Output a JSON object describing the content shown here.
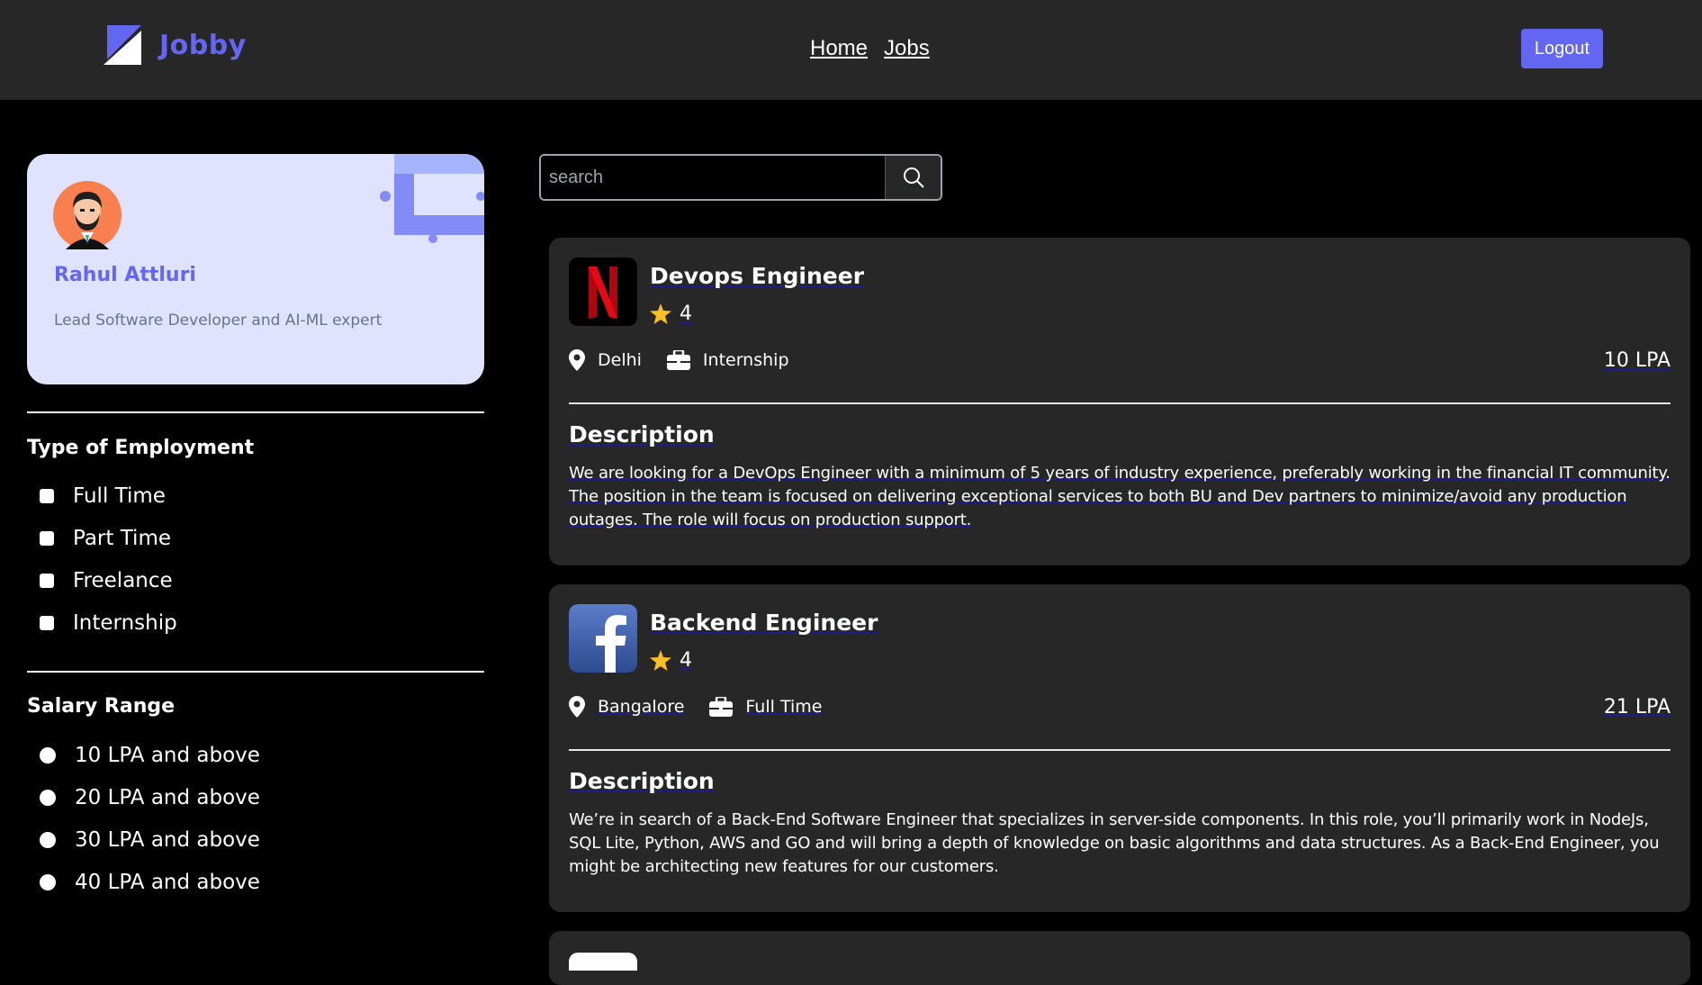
{
  "header": {
    "brand": "Jobby",
    "nav": [
      {
        "label": "Home"
      },
      {
        "label": "Jobs"
      }
    ],
    "logout_label": "Logout"
  },
  "profile": {
    "name": "Rahul Attluri",
    "bio": "Lead Software Developer and AI-ML expert"
  },
  "filters": {
    "employment_title": "Type of Employment",
    "employment_options": [
      "Full Time",
      "Part Time",
      "Freelance",
      "Internship"
    ],
    "salary_title": "Salary Range",
    "salary_options": [
      "10 LPA and above",
      "20 LPA and above",
      "30 LPA and above",
      "40 LPA and above"
    ]
  },
  "search": {
    "placeholder": "search"
  },
  "jobs": [
    {
      "logo": "netflix-logo",
      "title": "Devops Engineer",
      "rating": "4",
      "location": "Delhi",
      "employment_type": "Internship",
      "salary": "10 LPA",
      "description_heading": "Description",
      "description": "We are looking for a DevOps Engineer with a minimum of 5 years of industry experience, preferably working in the financial IT community. The position in the team is focused on delivering exceptional services to both BU and Dev partners to minimize/avoid any production outages. The role will focus on production support."
    },
    {
      "logo": "facebook-logo",
      "title": "Backend Engineer",
      "rating": "4",
      "location": "Bangalore",
      "employment_type": "Full Time",
      "salary": "21 LPA",
      "description_heading": "Description",
      "description": "We’re in search of a Back-End Software Engineer that specializes in server-side components. In this role, you’ll primarily work in NodeJs, SQL Lite, Python, AWS and GO and will bring a depth of knowledge on basic algorithms and data structures. As a Back-End Engineer, you might be architecting new features for our customers."
    }
  ],
  "colors": {
    "accent": "#6366f1",
    "header_bg": "#272727",
    "card_bg": "#272727",
    "profile_bg": "#e0e3ff",
    "star": "#fbbf24"
  }
}
